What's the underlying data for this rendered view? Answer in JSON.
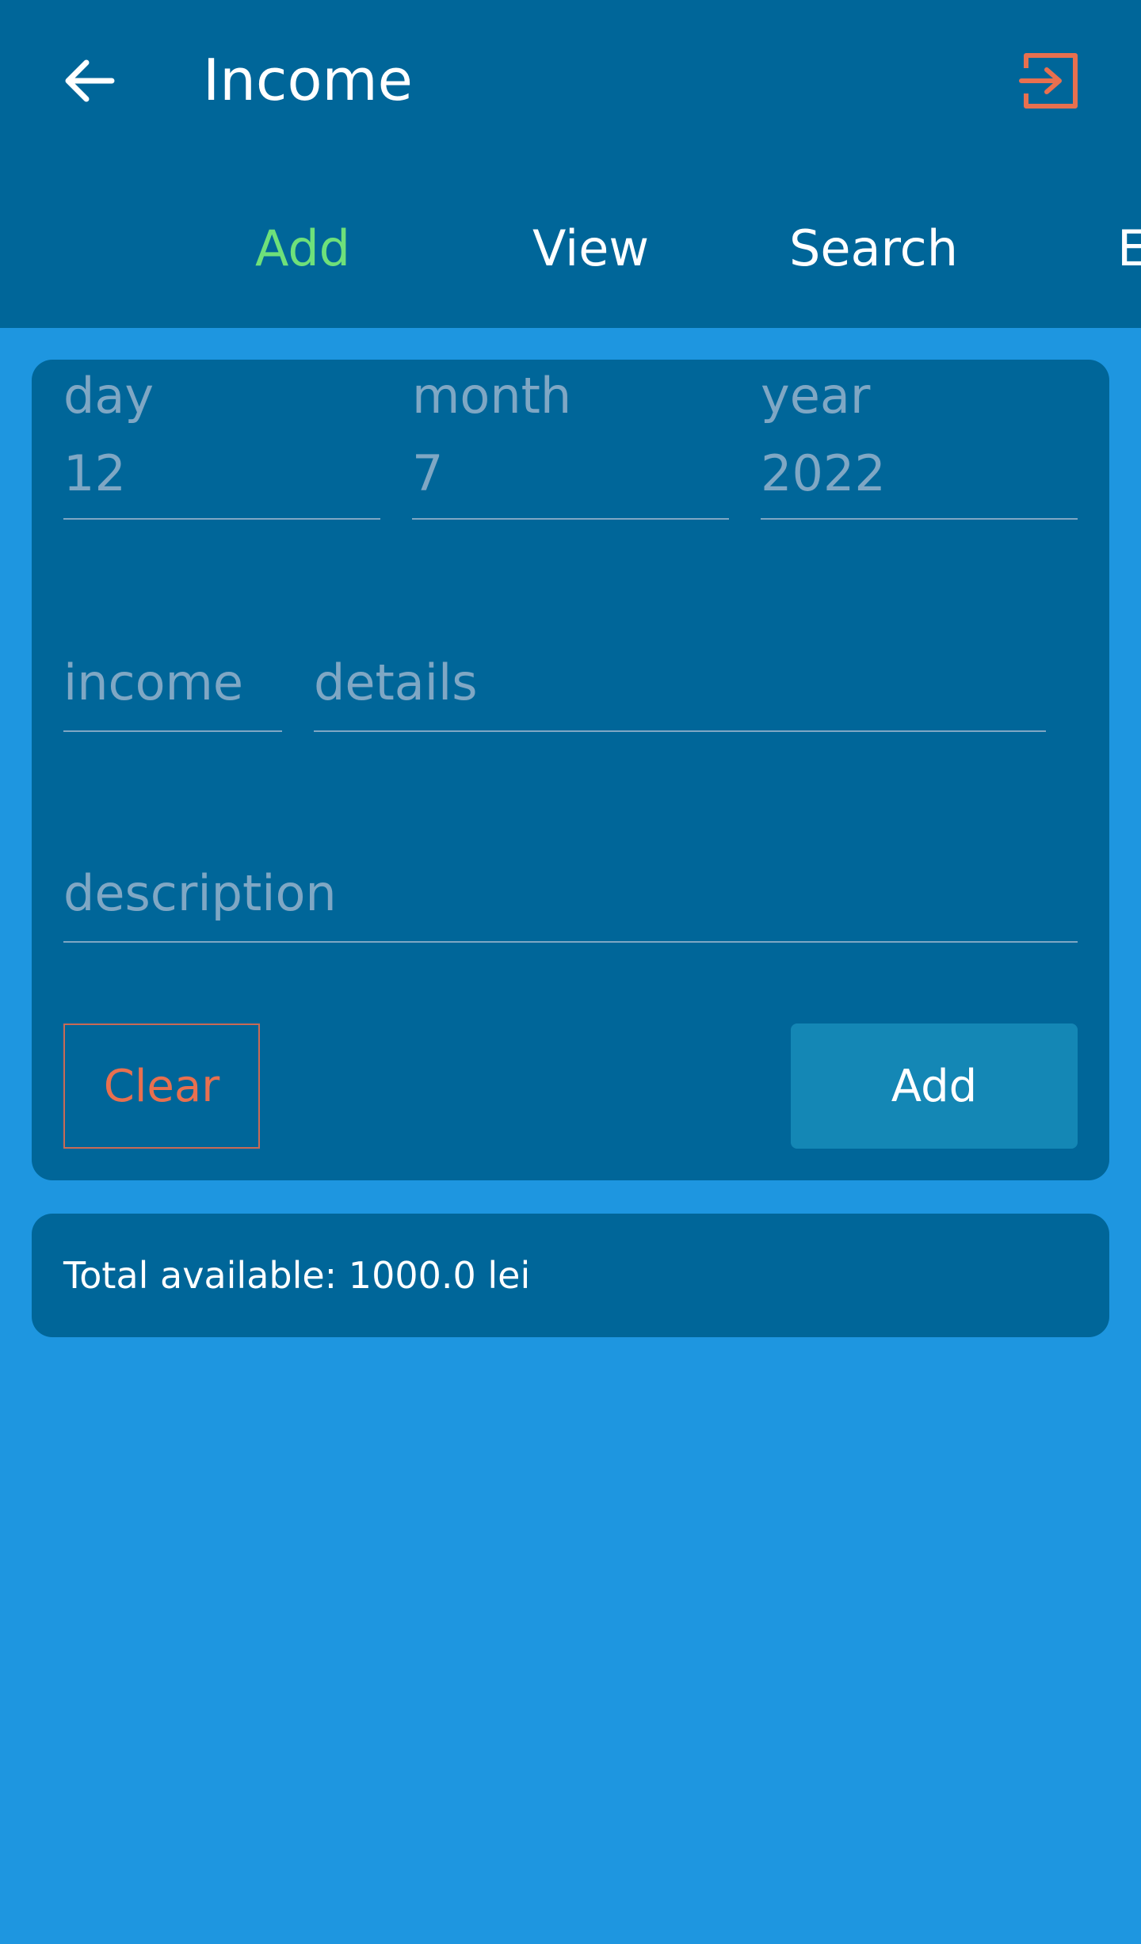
{
  "header": {
    "title": "Income",
    "back_icon": "arrow-left-icon",
    "logout_icon": "logout-icon"
  },
  "tabs": [
    {
      "label": "Add",
      "active": true
    },
    {
      "label": "View",
      "active": false
    },
    {
      "label": "Search",
      "active": false
    },
    {
      "label": "E",
      "active": false
    }
  ],
  "form": {
    "day": {
      "label": "day",
      "value": "12"
    },
    "month": {
      "label": "month",
      "value": "7"
    },
    "year": {
      "label": "year",
      "value": "2022"
    },
    "income": {
      "label": "income"
    },
    "details": {
      "label": "details"
    },
    "description": {
      "label": "description"
    },
    "clear_label": "Clear",
    "add_label": "Add"
  },
  "total": {
    "text": "Total available: 1000.0 lei"
  },
  "colors": {
    "appbar": "#006699",
    "background": "#1E96E0",
    "active_tab": "#6EE07A",
    "accent_orange": "#E8704F",
    "add_button": "#1487B5"
  }
}
